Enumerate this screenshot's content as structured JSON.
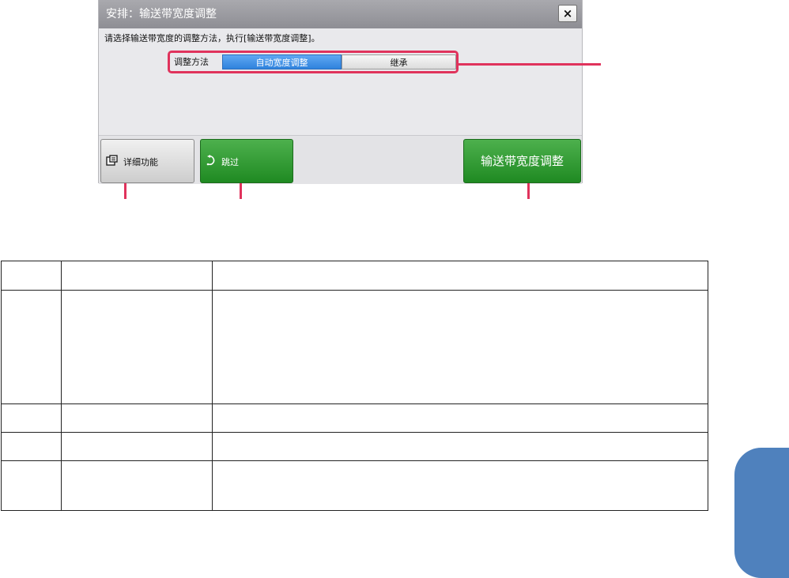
{
  "dialog": {
    "title": "安排：输送带宽度调整",
    "close_label": "×",
    "instruction": "请选择输送带宽度的调整方法，执行[输送带宽度调整]。",
    "method": {
      "label": "调整方法",
      "options": [
        "自动宽度调整",
        "继承"
      ],
      "selected": "自动宽度调整"
    },
    "buttons": {
      "detail": "详细功能",
      "skip": "跳过",
      "adjust": "输送带宽度调整"
    }
  },
  "colors": {
    "callout": "#e0335c",
    "green_button": "#2d9a30",
    "selected_segment": "#3a8de6",
    "side_tab": "#4f81bd"
  },
  "table": {
    "rows": [
      [
        "",
        "",
        ""
      ],
      [
        "",
        "",
        ""
      ],
      [
        "",
        "",
        ""
      ],
      [
        "",
        "",
        ""
      ],
      [
        "",
        "",
        ""
      ]
    ]
  }
}
